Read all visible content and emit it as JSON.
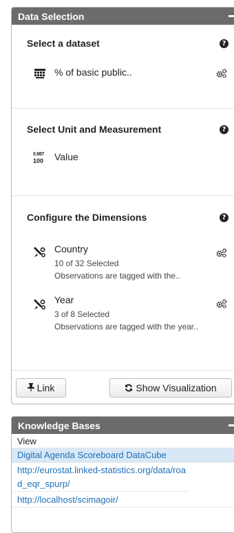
{
  "data_selection": {
    "header": "Data Selection",
    "dataset": {
      "title": "Select a dataset",
      "name": "% of basic public.."
    },
    "measurement": {
      "title": "Select Unit and Measurement",
      "icon_text_top": "0.987",
      "icon_text_bottom": "100",
      "name": "Value"
    },
    "dimensions": {
      "title": "Configure the Dimensions",
      "items": [
        {
          "name": "Country",
          "count": "10 of 32 Selected",
          "desc": "Observations are tagged with the.."
        },
        {
          "name": "Year",
          "count": "3 of 8 Selected",
          "desc": "Observations are tagged with the year.."
        }
      ]
    },
    "buttons": {
      "link": "Link",
      "visualize": "Show Visualization"
    }
  },
  "knowledge_bases": {
    "header": "Knowledge Bases",
    "view_label": "View",
    "items": [
      "Digital Agenda Scoreboard DataCube",
      "http://eurostat.linked-statistics.org/data/road_eqr_spurp/",
      "http://localhost/scimagoir/"
    ],
    "selected_index": 0
  }
}
